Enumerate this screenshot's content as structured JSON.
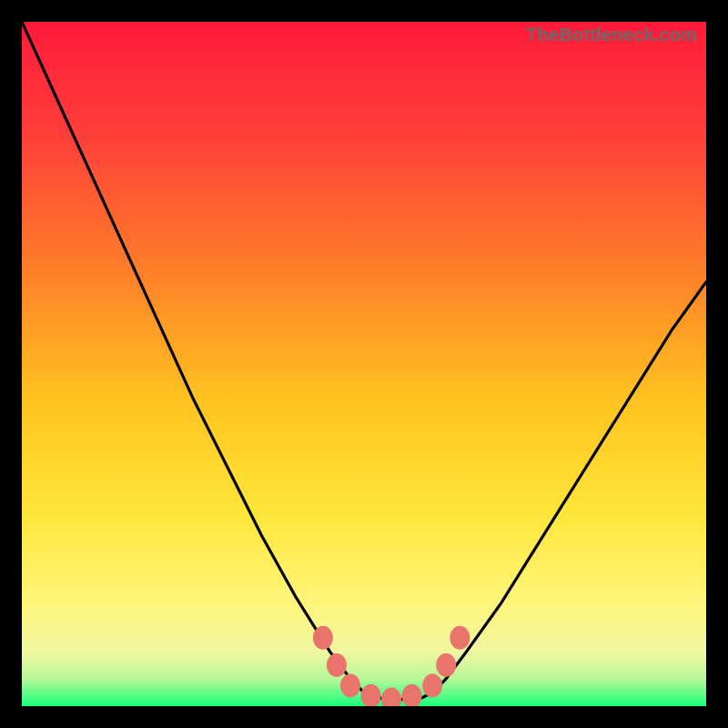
{
  "watermark": "TheBottleneck.com",
  "colors": {
    "frame": "#000000",
    "gradient_top": "#ff1a3a",
    "gradient_mid_hi": "#ff6a2e",
    "gradient_mid": "#ffd22a",
    "gradient_mid_lo": "#ffe24a",
    "gradient_low": "#f7f4a0",
    "gradient_bottom": "#19ff7a",
    "curve": "#000000",
    "marker": "#e9746c"
  },
  "chart_data": {
    "type": "line",
    "title": "",
    "xlabel": "",
    "ylabel": "",
    "xlim": [
      0,
      100
    ],
    "ylim": [
      0,
      100
    ],
    "series": [
      {
        "name": "bottleneck-curve",
        "x": [
          0,
          5,
          10,
          15,
          20,
          25,
          30,
          35,
          40,
          45,
          48,
          50,
          53,
          55,
          58,
          60,
          62,
          65,
          70,
          75,
          80,
          85,
          90,
          95,
          100
        ],
        "y": [
          100,
          89,
          78,
          67,
          56,
          45,
          35,
          25,
          16,
          8,
          4,
          2,
          1,
          1,
          1,
          2,
          4,
          8,
          15,
          23,
          31,
          39,
          47,
          55,
          62
        ]
      }
    ],
    "markers": {
      "name": "highlight-points",
      "x": [
        44,
        46,
        48,
        51,
        54,
        57,
        60,
        62,
        64
      ],
      "y": [
        10,
        6,
        3,
        1.5,
        1,
        1.5,
        3,
        6,
        10
      ]
    }
  }
}
